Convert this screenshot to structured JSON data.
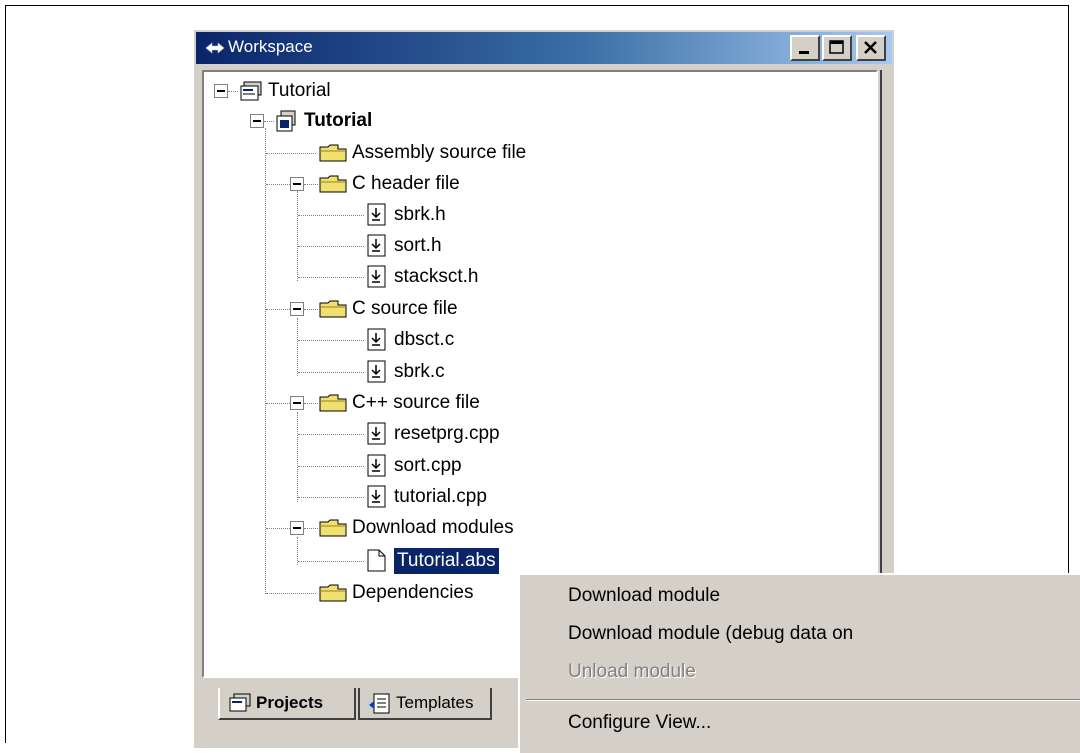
{
  "window": {
    "title": "Workspace"
  },
  "tree": [
    {
      "label": "Tutorial",
      "icon": "workspace-icon"
    },
    {
      "label": "Tutorial",
      "icon": "project-icon",
      "bold": true
    },
    {
      "label": "Assembly source file",
      "icon": "folder-icon"
    },
    {
      "label": "C header file",
      "icon": "folder-icon"
    },
    {
      "label": "sbrk.h",
      "icon": "file-icon"
    },
    {
      "label": "sort.h",
      "icon": "file-icon"
    },
    {
      "label": "stacksct.h",
      "icon": "file-icon"
    },
    {
      "label": "C source file",
      "icon": "folder-icon"
    },
    {
      "label": "dbsct.c",
      "icon": "file-icon"
    },
    {
      "label": "sbrk.c",
      "icon": "file-icon"
    },
    {
      "label": "C++ source file",
      "icon": "folder-icon"
    },
    {
      "label": "resetprg.cpp",
      "icon": "file-icon"
    },
    {
      "label": "sort.cpp",
      "icon": "file-icon"
    },
    {
      "label": "tutorial.cpp",
      "icon": "file-icon"
    },
    {
      "label": "Download modules",
      "icon": "folder-icon"
    },
    {
      "label": "Tutorial.abs",
      "icon": "module-icon",
      "selected": true
    },
    {
      "label": "Dependencies",
      "icon": "folder-icon"
    }
  ],
  "tabs": [
    {
      "label": "Projects",
      "active": true
    },
    {
      "label": "Templates",
      "active": false
    }
  ],
  "context_menu": {
    "items": [
      {
        "label": "Download module",
        "enabled": true
      },
      {
        "label": "Download module (debug data on",
        "enabled": true
      },
      {
        "label": "Unload module",
        "enabled": false
      },
      {
        "label": "Configure View...",
        "enabled": true
      }
    ]
  },
  "colors": {
    "titlebar_start": "#0a246a",
    "titlebar_end": "#a6caf0",
    "selection": "#0a246a",
    "face": "#d4d0c8"
  }
}
